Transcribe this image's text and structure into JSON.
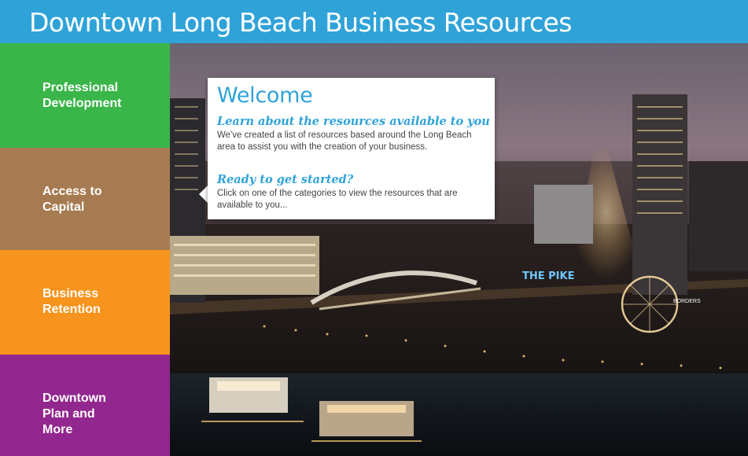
{
  "header": {
    "title": "Downtown Long Beach Business Resources"
  },
  "sidebar": {
    "items": [
      {
        "label": "Professional\nDevelopment",
        "color": "#3ab54a"
      },
      {
        "label": "Access to\nCapital",
        "color": "#a77b51"
      },
      {
        "label": "Business\nRetention",
        "color": "#f7941d"
      },
      {
        "label": "Downtown\nPlan and\nMore",
        "color": "#92278f"
      }
    ]
  },
  "welcome": {
    "title": "Welcome",
    "sections": [
      {
        "heading": "Learn about the resources available to you",
        "text": "We've created a list of resources based around the Long Beach area to assist you with the creation of your business."
      },
      {
        "heading": "Ready to get started?",
        "text": "Click on one of the categories to view the resources that are available to you..."
      }
    ]
  },
  "scene": {
    "signs": {
      "pike": "THE PIKE",
      "borders": "BORDERS"
    }
  },
  "colors": {
    "header": "#2fa3d8",
    "accent": "#2fa3d8"
  }
}
